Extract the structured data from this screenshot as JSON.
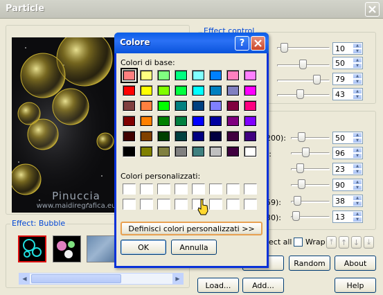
{
  "particle": {
    "title": "Particle",
    "effect_control_label": "Effect control",
    "effect_label": "Effect: Bubble",
    "watermark_name": "Pinuccia",
    "watermark_url": "www.maidiregrafica.eu",
    "top_values": [
      "10",
      "50",
      "79",
      "43"
    ],
    "bottom_labels": [
      "200):",
      "):",
      "",
      "",
      "59):",
      "30):"
    ],
    "bottom_values": [
      "50",
      "96",
      "23",
      "90",
      "38",
      "13"
    ],
    "select_all_label": "ect all",
    "wrap_label": "Wrap",
    "buttons": {
      "cancel": "cel",
      "random": "Random",
      "about": "About",
      "load": "Load...",
      "add": "Add...",
      "help": "Help"
    }
  },
  "colore": {
    "title": "Colore",
    "basic_colors_label": "Colori di base:",
    "custom_colors_label": "Colori personalizzati:",
    "define_custom_button": "Definisci colori personalizzati >>",
    "ok_button": "OK",
    "cancel_button": "Annulla",
    "selected_index": 0,
    "basic_colors": [
      "#ff8080",
      "#ffff80",
      "#80ff80",
      "#00ff80",
      "#80ffff",
      "#0080ff",
      "#ff80c0",
      "#ff80ff",
      "#ff0000",
      "#ffff00",
      "#80ff00",
      "#00ff40",
      "#00ffff",
      "#0080c0",
      "#8080c0",
      "#ff00ff",
      "#804040",
      "#ff8040",
      "#00ff00",
      "#008080",
      "#004080",
      "#8080ff",
      "#800040",
      "#ff0080",
      "#800000",
      "#ff8000",
      "#008000",
      "#008040",
      "#0000ff",
      "#0000a0",
      "#800080",
      "#8000ff",
      "#400000",
      "#804000",
      "#004000",
      "#004040",
      "#000080",
      "#000040",
      "#400040",
      "#400080",
      "#000000",
      "#808000",
      "#808040",
      "#808080",
      "#408080",
      "#c0c0c0",
      "#400040",
      "#ffffff"
    ],
    "custom_colors": [
      "#ffffff",
      "#ffffff",
      "#ffffff",
      "#ffffff",
      "#ffffff",
      "#ffffff",
      "#ffffff",
      "#ffffff",
      "#ffffff",
      "#ffffff",
      "#ffffff",
      "#ffffff",
      "#ffffff",
      "#ffffff",
      "#ffffff",
      "#ffffff"
    ]
  }
}
